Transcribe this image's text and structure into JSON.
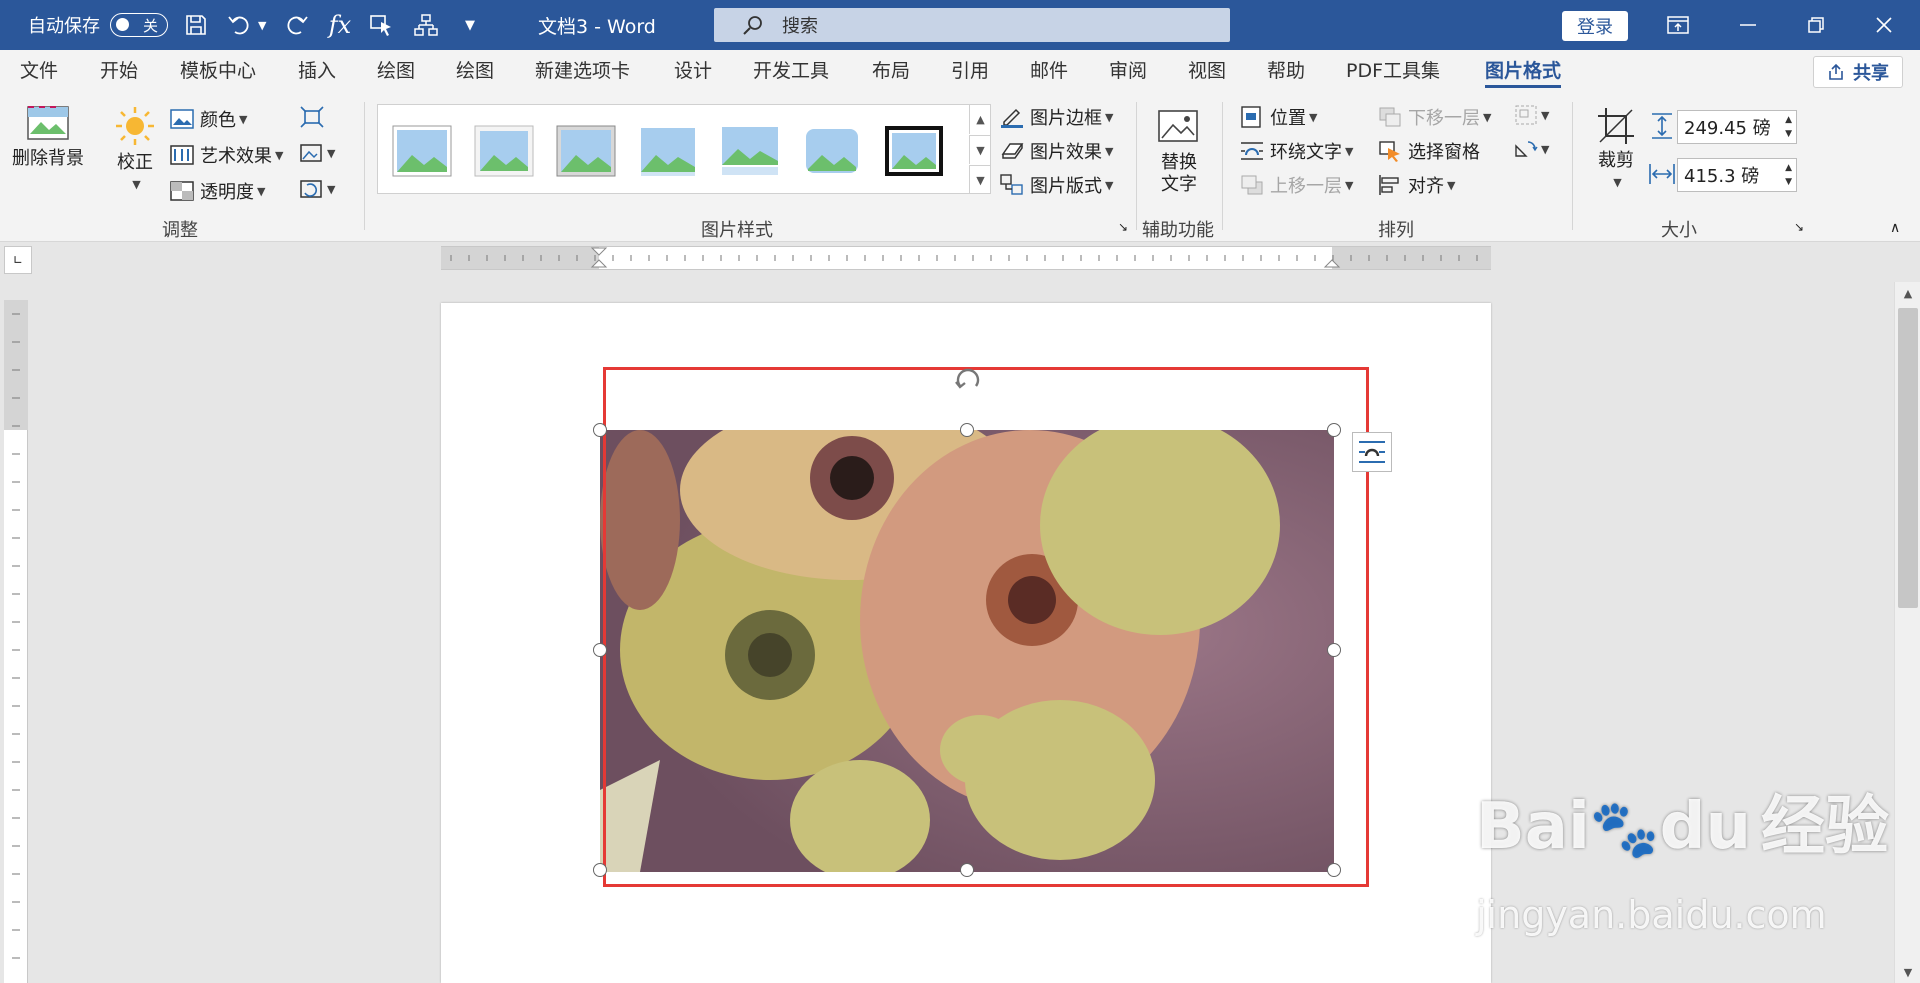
{
  "titlebar": {
    "autosave_label": "自动保存",
    "autosave_state": "关",
    "doc_title": "文档3  -  Word",
    "search_placeholder": "搜索",
    "login": "登录",
    "color": "#2b579a"
  },
  "menu": {
    "tabs": [
      "文件",
      "开始",
      "模板中心",
      "插入",
      "绘图",
      "绘图",
      "新建选项卡",
      "设计",
      "开发工具",
      "布局",
      "引用",
      "邮件",
      "审阅",
      "视图",
      "帮助",
      "PDF工具集",
      "图片格式"
    ],
    "active": "图片格式",
    "share": "共享"
  },
  "ribbon": {
    "remove_bg": "删除背景",
    "corrections": "校正",
    "color": "颜色",
    "artistic": "艺术效果",
    "transparency": "透明度",
    "group_adjust": "调整",
    "picture_border": "图片边框",
    "picture_effects": "图片效果",
    "picture_layout": "图片版式",
    "group_styles": "图片样式",
    "alt_text_line1": "替换",
    "alt_text_line2": "文字",
    "group_accessibility": "辅助功能",
    "position": "位置",
    "wrap_text": "环绕文字",
    "bring_forward": "上移一层",
    "send_backward": "下移一层",
    "selection_pane": "选择窗格",
    "align": "对齐",
    "group_arrange": "排列",
    "crop": "裁剪",
    "height": "249.45 磅",
    "width": "415.3 磅",
    "group_size": "大小"
  },
  "icons": {
    "save": "save-icon",
    "undo": "undo-icon",
    "redo": "redo-icon",
    "function": "function-icon",
    "search": "search-icon",
    "rotate": "rotate-icon",
    "layout_options": "layout-options-icon"
  },
  "watermark": {
    "brand": "Bai",
    "brand_suffix": "du",
    "brand_cn": "经验",
    "url": "jingyan.baidu.com"
  }
}
